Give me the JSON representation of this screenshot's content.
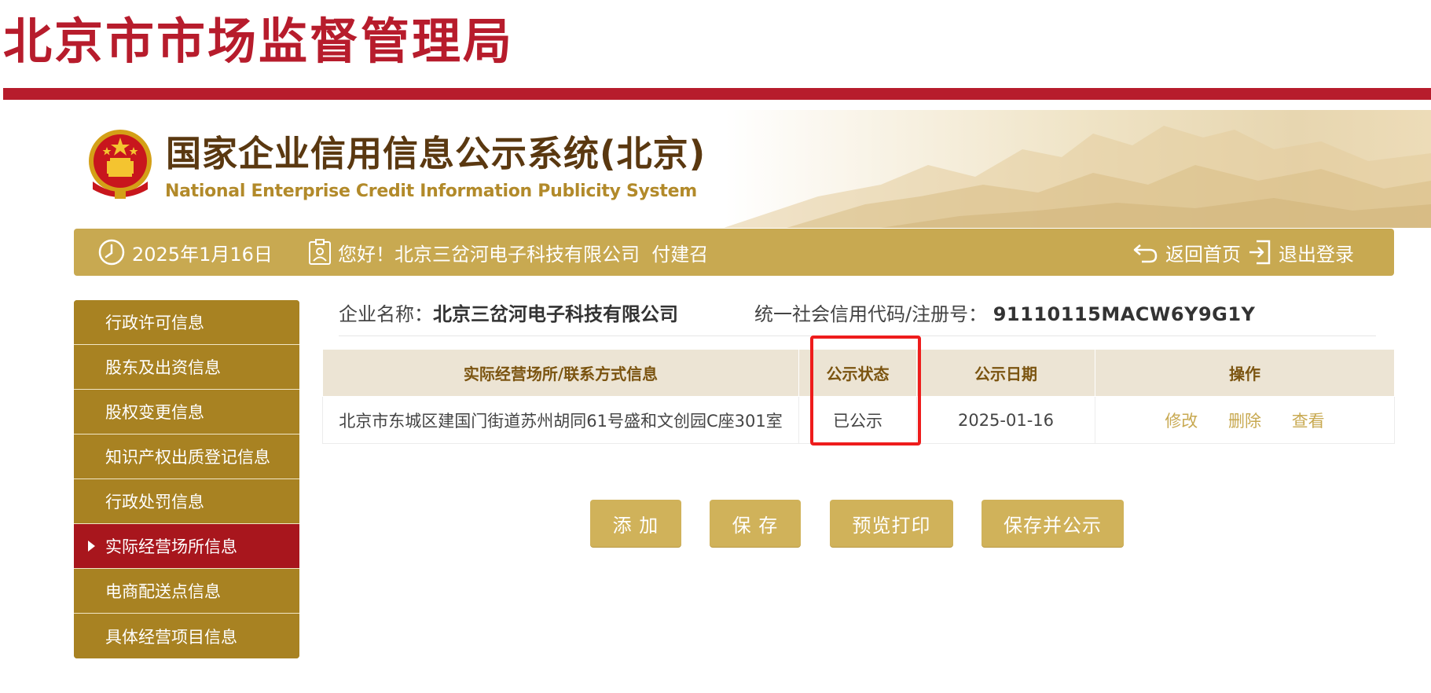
{
  "header": {
    "bureau_title": "北京市市场监督管理局",
    "system_title": "国家企业信用信息公示系统(北京)",
    "system_subtitle": "National Enterprise Credit Information Publicity System"
  },
  "topbar": {
    "date": "2025年1月16日",
    "greeting": "您好！北京三岔河电子科技有限公司  付建召",
    "home_label": "返回首页",
    "logout_label": "退出登录"
  },
  "sidebar": {
    "items": [
      {
        "label": "行政许可信息",
        "active": false
      },
      {
        "label": "股东及出资信息",
        "active": false
      },
      {
        "label": "股权变更信息",
        "active": false
      },
      {
        "label": "知识产权出质登记信息",
        "active": false
      },
      {
        "label": "行政处罚信息",
        "active": false
      },
      {
        "label": "实际经营场所信息",
        "active": true
      },
      {
        "label": "电商配送点信息",
        "active": false
      },
      {
        "label": "具体经营项目信息",
        "active": false
      }
    ]
  },
  "company": {
    "name_label": "企业名称：",
    "name": "北京三岔河电子科技有限公司",
    "code_label": "统一社会信用代码/注册号：",
    "code": "91110115MACW6Y9G1Y"
  },
  "table": {
    "headers": [
      "实际经营场所/联系方式信息",
      "公示状态",
      "公示日期",
      "操作"
    ],
    "rows": [
      {
        "address": "北京市东城区建国门街道苏州胡同61号盛和文创园C座301室",
        "status": "已公示",
        "date": "2025-01-16",
        "actions": [
          "修改",
          "删除",
          "查看"
        ]
      }
    ]
  },
  "buttons": {
    "add": "添 加",
    "save": "保 存",
    "preview": "预览打印",
    "save_publish": "保存并公示"
  },
  "colors": {
    "brand_red": "#b71c2c",
    "gold": "#c8a951",
    "sidebar_gold": "#a88222",
    "active_red": "#a8161d",
    "highlight": "#ee1c1c"
  }
}
